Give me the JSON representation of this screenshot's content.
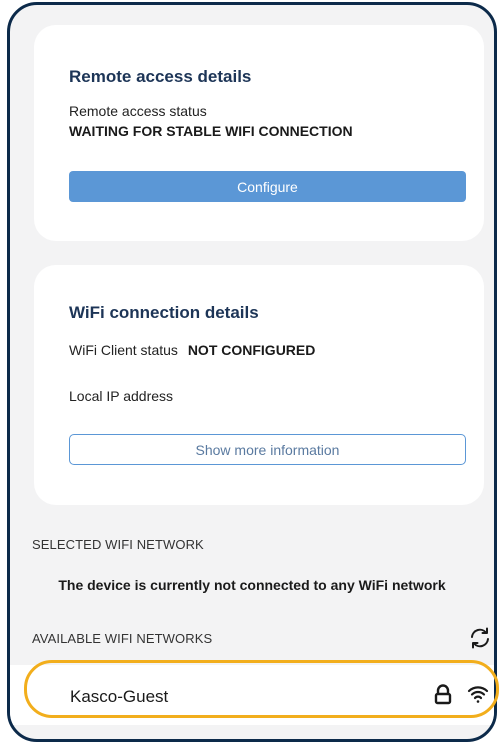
{
  "remote_access": {
    "title": "Remote access details",
    "status_label": "Remote access status",
    "status_value": "WAITING FOR STABLE WIFI CONNECTION",
    "configure_label": "Configure"
  },
  "wifi_details": {
    "title": "WiFi connection details",
    "client_status_label": "WiFi Client status",
    "client_status_value": "NOT CONFIGURED",
    "local_ip_label": "Local IP address",
    "show_more_label": "Show more information"
  },
  "selected_network": {
    "label": "SELECTED WIFI NETWORK",
    "message": "The device is currently not connected to any WiFi network"
  },
  "available_networks": {
    "label": "AVAILABLE WIFI NETWORKS",
    "refresh_icon": "refresh-icon",
    "items": [
      {
        "name": "Kasco-Guest",
        "secured": true,
        "signal": "full"
      }
    ]
  },
  "colors": {
    "accent": "#5b97d6",
    "highlight": "#f2ae1c",
    "frame": "#0c2a4a",
    "background": "#f3f3f4"
  }
}
